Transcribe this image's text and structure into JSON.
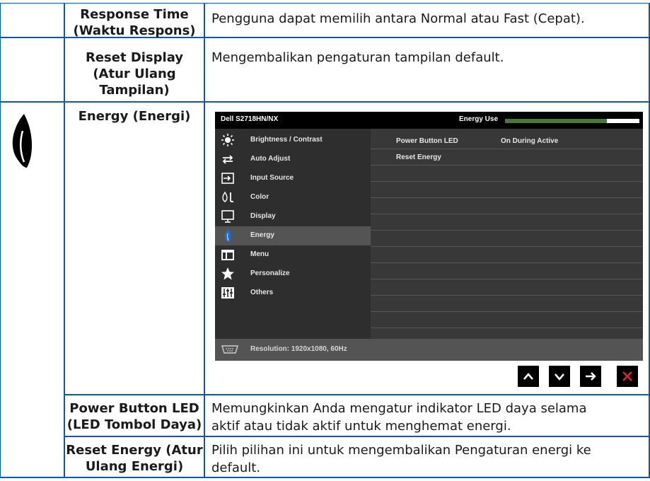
{
  "rows": [
    {
      "term": "Response Time (Waktu Respons)",
      "desc": "Pengguna dapat memilih antara Normal atau Fast (Cepat)."
    },
    {
      "term": "Reset Display (Atur Ulang Tampilan)",
      "desc": "Mengembalikan pengaturan tampilan default."
    },
    {
      "term": "Energy (Energi)"
    },
    {
      "term": "Power Button LED (LED Tombol Daya)",
      "desc": "Memungkinkan Anda mengatur indikator LED daya selama aktif atau tidak aktif untuk menghemat energi."
    },
    {
      "term": "Reset Energy (Atur Ulang Energi)",
      "desc": "Pilih pilihan ini untuk mengembalikan Pengaturan energi ke default."
    }
  ],
  "term_lines": {
    "response": [
      "Response Time",
      "(Waktu Respons)"
    ],
    "reset_display": [
      "Reset Display",
      "(Atur Ulang",
      "Tampilan)"
    ],
    "energy": [
      "Energy (Energi)"
    ],
    "power_led": [
      "Power Button LED",
      "(LED Tombol Daya)"
    ],
    "reset_energy": [
      "Reset Energy (Atur",
      "Ulang Energi)"
    ]
  },
  "desc_lines": {
    "power_led": [
      "Memungkinkan Anda mengatur indikator LED daya selama",
      "aktif atau tidak aktif untuk menghemat energi."
    ],
    "reset_energy": [
      "Pilih pilihan ini untuk mengembalikan Pengaturan energi ke",
      "default."
    ]
  },
  "icons": {
    "section": "energy-leaf-icon"
  },
  "osd": {
    "model": "Dell S2718HN/NX",
    "energy_use_label": "Energy Use",
    "energy_use_level": 0.76,
    "menu": [
      {
        "label": "Brightness / Contrast",
        "icon": "brightness-icon"
      },
      {
        "label": "Auto Adjust",
        "icon": "auto-adjust-icon"
      },
      {
        "label": "Input Source",
        "icon": "input-source-icon"
      },
      {
        "label": "Color",
        "icon": "color-icon"
      },
      {
        "label": "Display",
        "icon": "display-icon"
      },
      {
        "label": "Energy",
        "icon": "energy-icon",
        "selected": true
      },
      {
        "label": "Menu",
        "icon": "menu-icon"
      },
      {
        "label": "Personalize",
        "icon": "star-icon"
      },
      {
        "label": "Others",
        "icon": "others-icon"
      }
    ],
    "submenu": [
      {
        "label": "Power Button LED",
        "value": "On During Active"
      },
      {
        "label": "Reset Energy",
        "value": ""
      }
    ],
    "footer": "Resolution: 1920x1080, 60Hz",
    "nav_buttons": [
      "up-arrow-icon",
      "down-arrow-icon",
      "right-arrow-icon",
      "close-icon"
    ],
    "colors": {
      "osd_bg": "#3a3a3a",
      "selected": "#545454",
      "energy_bar": "#4a7a3a",
      "energy_icon": "#1f6fd1",
      "close": "#e0242b",
      "table_line": "#0e5aa7"
    }
  }
}
